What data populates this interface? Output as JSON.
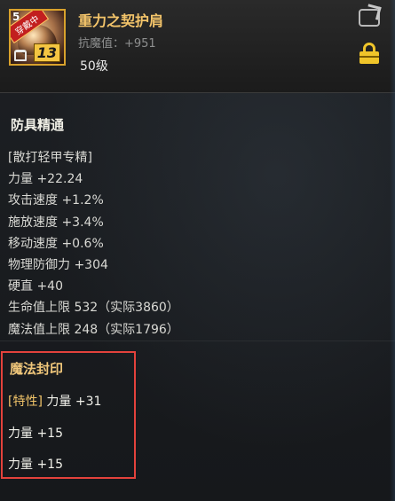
{
  "item": {
    "name": "重力之契护肩",
    "resist_label": "抗魔值：+951",
    "level": "50级",
    "icon_badge": "穿戴中",
    "icon_top_num": "5",
    "icon_level_num": "13"
  },
  "mastery": {
    "title": "防具精通",
    "lines": [
      "[散打轻甲专精]",
      "力量 +22.24",
      "攻击速度 +1.2%",
      "施放速度 +3.4%",
      "移动速度 +0.6%",
      "物理防御力 +304",
      "硬直 +40",
      "生命值上限 532（实际3860）",
      "魔法值上限 248（实际1796）"
    ]
  },
  "magic_seal": {
    "title": "魔法封印",
    "lines": [
      {
        "tag": "[特性]",
        "text": " 力量 +31"
      },
      {
        "tag": "",
        "text": "力量 +15"
      },
      {
        "tag": "",
        "text": "力量 +15"
      }
    ]
  },
  "colors": {
    "item_name": "#f3c46a",
    "highlight_box": "#e3423c",
    "lock": "#f0c52a"
  }
}
